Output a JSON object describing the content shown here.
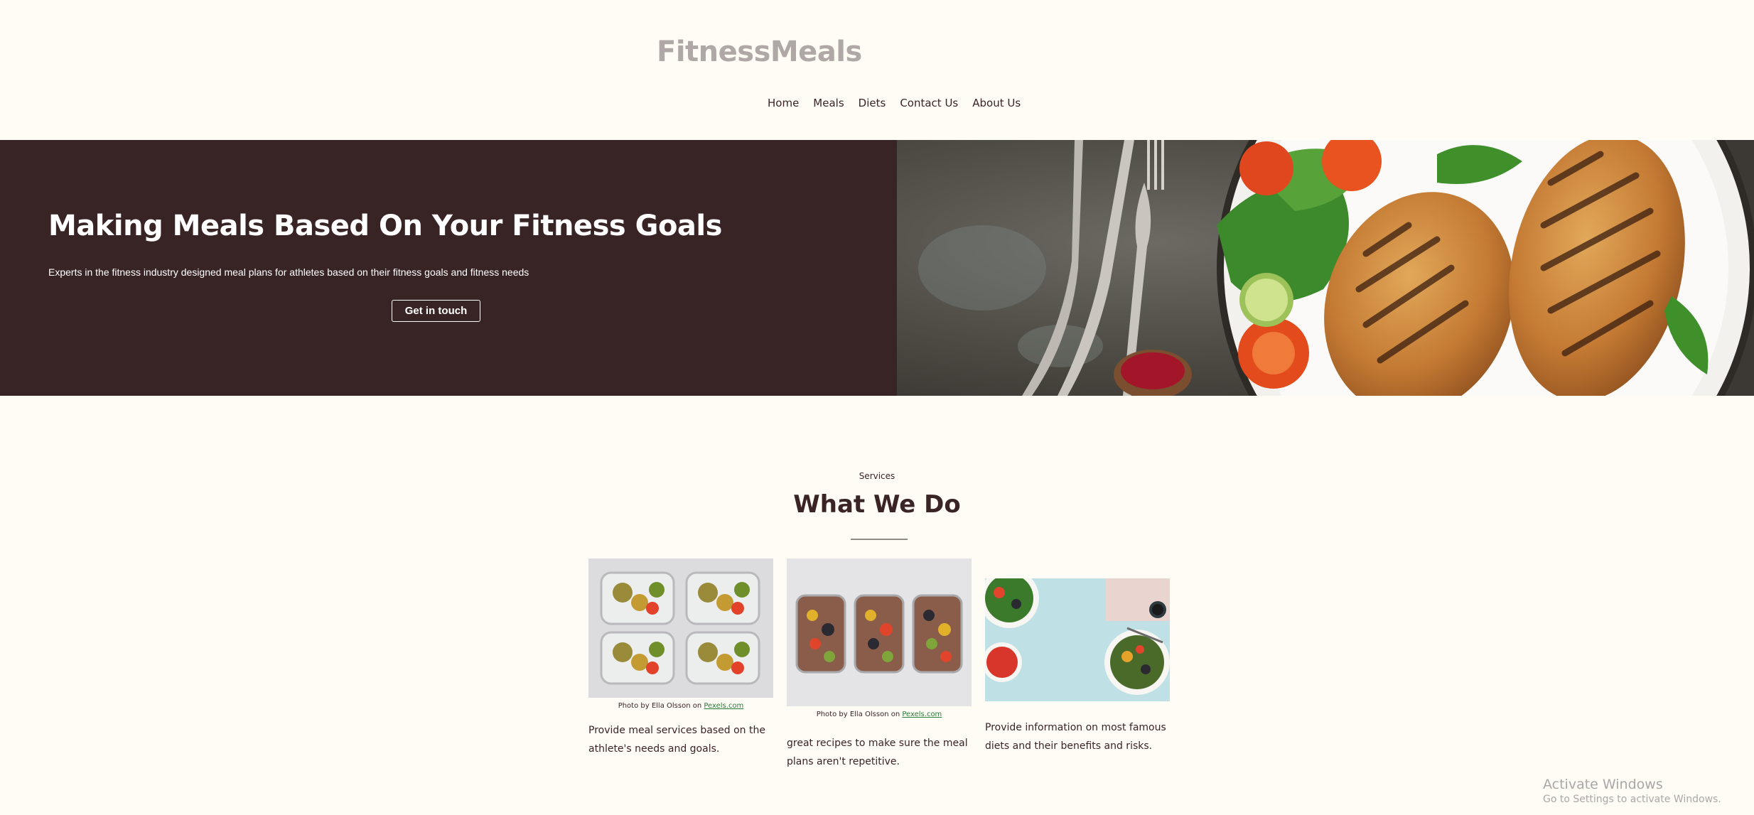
{
  "header": {
    "logo": "FitnessMeals",
    "nav": [
      "Home",
      "Meals",
      "Diets",
      "Contact Us",
      "About Us"
    ]
  },
  "hero": {
    "title": "Making Meals Based On Your Fitness Goals",
    "text": "Experts in the fitness industry designed meal plans for athletes based on their fitness goals and fitness needs",
    "button": "Get in touch",
    "image_icon": "grilled-chicken-salad-photo",
    "colors": {
      "left_bg": "#382424"
    }
  },
  "services": {
    "eyebrow": "Services",
    "title": "What We Do",
    "cards": [
      {
        "image_icon": "meal-prep-containers-photo",
        "caption_prefix": "Photo by Ella Olsson on ",
        "caption_link": "Pexels.com",
        "text": "Provide meal services based on the athlete's needs and goals."
      },
      {
        "image_icon": "grain-bowl-containers-photo",
        "caption_prefix": "Photo by Ella Olsson on ",
        "caption_link": "Pexels.com",
        "text": "great recipes to make sure the meal plans aren't repetitive."
      },
      {
        "image_icon": "salad-bowls-photo",
        "caption_prefix": "",
        "caption_link": "",
        "text": "Provide information on most famous diets and their benefits and risks."
      }
    ]
  },
  "watermark": {
    "title": "Activate Windows",
    "subtitle": "Go to Settings to activate Windows."
  },
  "colors": {
    "page_bg": "#fffcf5",
    "text": "#3a2424",
    "logo": "#b0a8a6"
  }
}
